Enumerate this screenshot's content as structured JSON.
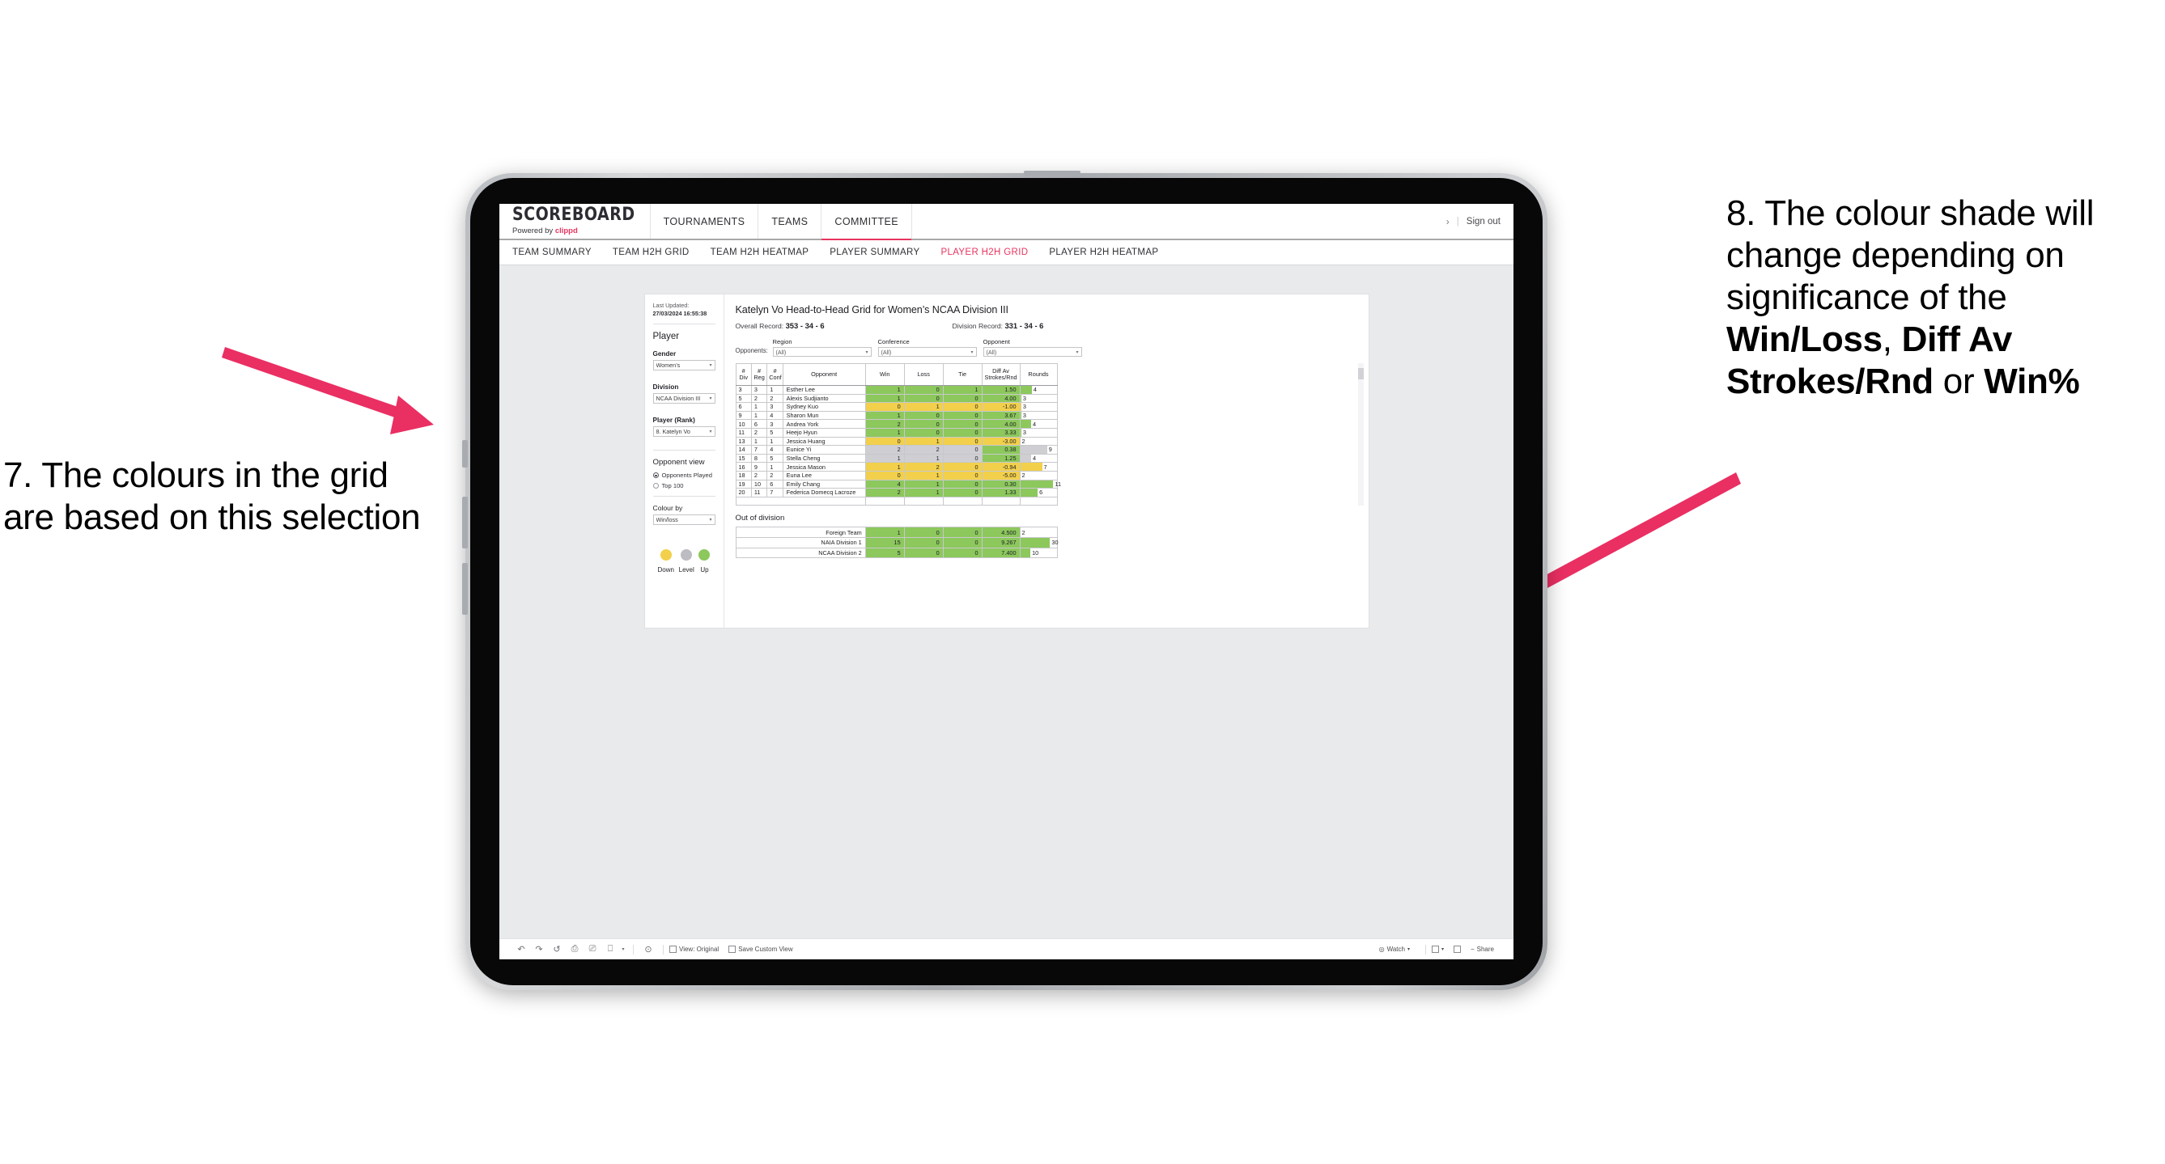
{
  "annotations": {
    "left": {
      "text": "7. The colours in the grid are based on this selection"
    },
    "right": {
      "pre": "8. The colour shade will change depending on significance of the ",
      "b1": "Win/Loss",
      "mid1": ", ",
      "b2": "Diff Av Strokes/Rnd",
      "mid2": " or ",
      "b3": "Win%"
    },
    "arrow_color": "#ea2f63"
  },
  "header": {
    "brand_title": "SCOREBOARD",
    "brand_sub_prefix": "Powered by ",
    "brand_sub_name": "clippd",
    "nav": [
      {
        "label": "TOURNAMENTS",
        "active": false
      },
      {
        "label": "TEAMS",
        "active": false
      },
      {
        "label": "COMMITTEE",
        "active": true
      }
    ],
    "chevron": "›",
    "divider": "|",
    "sign_out": "Sign out"
  },
  "subnav": [
    {
      "label": "TEAM SUMMARY",
      "active": false
    },
    {
      "label": "TEAM H2H GRID",
      "active": false
    },
    {
      "label": "TEAM H2H HEATMAP",
      "active": false
    },
    {
      "label": "PLAYER SUMMARY",
      "active": false
    },
    {
      "label": "PLAYER H2H GRID",
      "active": true
    },
    {
      "label": "PLAYER H2H HEATMAP",
      "active": false
    }
  ],
  "sidebar": {
    "last_updated_label": "Last Updated: ",
    "last_updated_value": "27/03/2024 16:55:38",
    "player_heading": "Player",
    "gender_label": "Gender",
    "gender_value": "Women’s",
    "division_label": "Division",
    "division_value": "NCAA Division III",
    "player_rank_label": "Player (Rank)",
    "player_rank_value": "8. Katelyn Vo",
    "opponent_view_heading": "Opponent view",
    "opponent_view_options": [
      {
        "label": "Opponents Played",
        "selected": true
      },
      {
        "label": "Top 100",
        "selected": false
      }
    ],
    "colour_by_label": "Colour by",
    "colour_by_value": "Win/loss",
    "legend": [
      {
        "label": "Down",
        "color": "#f2d04b"
      },
      {
        "label": "Level",
        "color": "#bcbcc2"
      },
      {
        "label": "Up",
        "color": "#8cc85c"
      }
    ],
    "caret": "▾"
  },
  "main": {
    "title": "Katelyn Vo Head-to-Head Grid for Women’s NCAA Division III",
    "overall_record_label": "Overall Record: ",
    "overall_record_value": "353 -  34 - 6",
    "division_record_label": "Division Record: ",
    "division_record_value": "331 -  34 - 6",
    "opponents_label": "Opponents:",
    "filters": [
      {
        "label": "Region",
        "value": "(All)"
      },
      {
        "label": "Conference",
        "value": "(All)"
      },
      {
        "label": "Opponent",
        "value": "(All)"
      }
    ],
    "caret": "▾"
  },
  "table": {
    "headers": [
      "#\nDiv",
      "#\nReg",
      "#\nConf",
      "Opponent",
      "Win",
      "Loss",
      "Tie",
      "Diff Av\nStrokes/Rnd",
      "Rounds"
    ],
    "header_div": "#",
    "header_div2": "Div",
    "header_reg": "#",
    "header_reg2": "Reg",
    "header_conf": "#",
    "header_conf2": "Conf",
    "header_opponent": "Opponent",
    "header_win": "Win",
    "header_loss": "Loss",
    "header_tie": "Tie",
    "header_diff1": "Diff Av",
    "header_diff2": "Strokes/Rnd",
    "header_rounds": "Rounds",
    "rows": [
      {
        "div": "3",
        "reg": "3",
        "conf": "1",
        "opponent": "Esther Lee",
        "win": "1",
        "loss": "0",
        "tie": "1",
        "diff": "1.50",
        "rounds": "4",
        "fill": "#8cc85c",
        "bar_pct": 32
      },
      {
        "div": "5",
        "reg": "2",
        "conf": "2",
        "opponent": "Alexis Sudjianto",
        "win": "1",
        "loss": "0",
        "tie": "0",
        "diff": "4.00",
        "rounds": "3",
        "fill": "#8cc85c",
        "bar_pct": 3
      },
      {
        "div": "6",
        "reg": "1",
        "conf": "3",
        "opponent": "Sydney Kuo",
        "win": "0",
        "loss": "1",
        "tie": "0",
        "diff": "-1.00",
        "rounds": "3",
        "fill": "#f2d04b",
        "bar_pct": 3
      },
      {
        "div": "9",
        "reg": "1",
        "conf": "4",
        "opponent": "Sharon Mun",
        "win": "1",
        "loss": "0",
        "tie": "0",
        "diff": "3.67",
        "rounds": "3",
        "fill": "#8cc85c",
        "bar_pct": 3
      },
      {
        "div": "10",
        "reg": "6",
        "conf": "3",
        "opponent": "Andrea York",
        "win": "2",
        "loss": "0",
        "tie": "0",
        "diff": "4.00",
        "rounds": "4",
        "fill": "#8cc85c",
        "bar_pct": 30
      },
      {
        "div": "11",
        "reg": "2",
        "conf": "5",
        "opponent": "Heejo Hyun",
        "win": "1",
        "loss": "0",
        "tie": "0",
        "diff": "3.33",
        "rounds": "3",
        "fill": "#8cc85c",
        "bar_pct": 3
      },
      {
        "div": "13",
        "reg": "1",
        "conf": "1",
        "opponent": "Jessica Huang",
        "win": "0",
        "loss": "1",
        "tie": "0",
        "diff": "-3.00",
        "rounds": "2",
        "fill": "#f2d04b",
        "bar_pct": 0
      },
      {
        "div": "14",
        "reg": "7",
        "conf": "4",
        "opponent": "Eunice Yi",
        "win": "2",
        "loss": "2",
        "tie": "0",
        "diff": "0.38",
        "rounds": "9",
        "fill": "#cfcfd3",
        "diff_fill": "#8cc85c",
        "bar_pct": 74
      },
      {
        "div": "15",
        "reg": "8",
        "conf": "5",
        "opponent": "Stella Cheng",
        "win": "1",
        "loss": "1",
        "tie": "0",
        "diff": "1.25",
        "rounds": "4",
        "fill": "#cfcfd3",
        "diff_fill": "#8cc85c",
        "bar_pct": 30
      },
      {
        "div": "16",
        "reg": "9",
        "conf": "1",
        "opponent": "Jessica Mason",
        "win": "1",
        "loss": "2",
        "tie": "0",
        "diff": "-0.94",
        "rounds": "7",
        "fill": "#f2d04b",
        "bar_pct": 60
      },
      {
        "div": "18",
        "reg": "2",
        "conf": "2",
        "opponent": "Euna Lee",
        "win": "0",
        "loss": "1",
        "tie": "0",
        "diff": "-5.00",
        "rounds": "2",
        "fill": "#f2d04b",
        "bar_pct": 0
      },
      {
        "div": "19",
        "reg": "10",
        "conf": "6",
        "opponent": "Emily Chang",
        "win": "4",
        "loss": "1",
        "tie": "0",
        "diff": "0.30",
        "rounds": "11",
        "fill": "#8cc85c",
        "bar_pct": 91
      },
      {
        "div": "20",
        "reg": "11",
        "conf": "7",
        "opponent": "Federica Domecq Lacroze",
        "win": "2",
        "loss": "1",
        "tie": "0",
        "diff": "1.33",
        "rounds": "6",
        "fill": "#8cc85c",
        "bar_pct": 48
      }
    ]
  },
  "out_of_division": {
    "title": "Out of division",
    "rows": [
      {
        "name": "Foreign Team",
        "win": "1",
        "loss": "0",
        "tie": "0",
        "diff": "4.500",
        "rounds": "2",
        "fill": "#8cc85c",
        "bar_pct": 0
      },
      {
        "name": "NAIA Division 1",
        "win": "15",
        "loss": "0",
        "tie": "0",
        "diff": "9.267",
        "rounds": "30",
        "fill": "#8cc85c",
        "bar_pct": 82
      },
      {
        "name": "NCAA Division 2",
        "win": "5",
        "loss": "0",
        "tie": "0",
        "diff": "7.400",
        "rounds": "10",
        "fill": "#8cc85c",
        "bar_pct": 28
      }
    ]
  },
  "toolbar": {
    "view_original": "View: Original",
    "save_custom_view": "Save Custom View",
    "watch": "Watch",
    "share": "Share",
    "caret": "▾",
    "undo": "↶",
    "redo": "↷",
    "revert": "↺",
    "refresh": "⥁",
    "pause": "⏸",
    "alert": "⊙"
  }
}
